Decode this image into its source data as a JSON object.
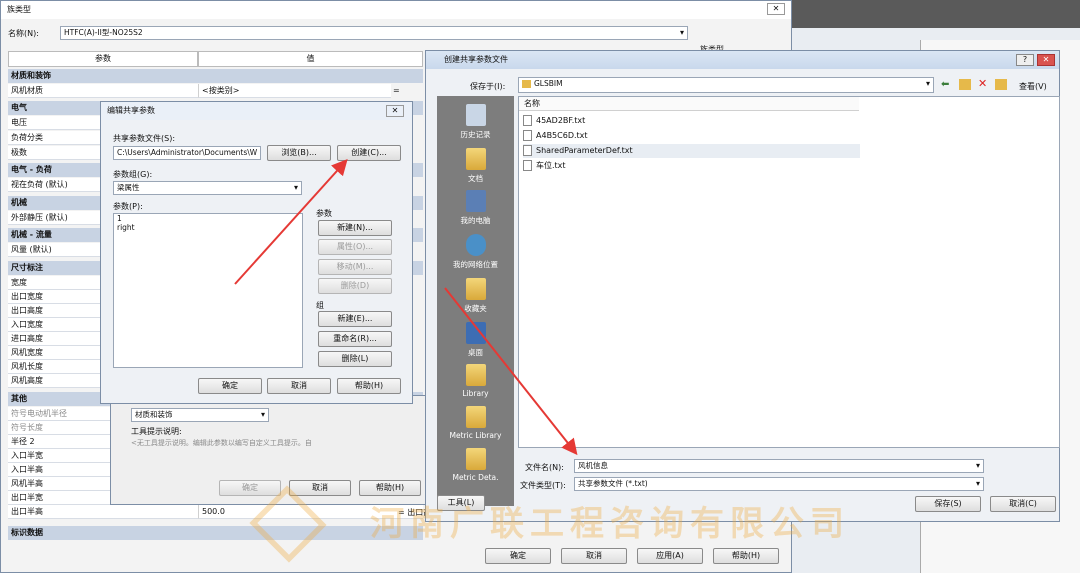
{
  "family_dialog": {
    "title": "族类型",
    "name_label": "名称(N):",
    "name_value": "HTFC(A)-II型-NO25S2",
    "col_param": "参数",
    "col_value": "值",
    "rows": {
      "cat_material": "材质和装饰",
      "fan_material": "风机材质",
      "fan_material_value": "<按类别>",
      "fan_material_eq": "=",
      "cat_electrical": "电气",
      "voltage": "电压",
      "load_class": "负荷分类",
      "poles": "极数",
      "cat_elec_load": "电气 - 负荷",
      "apparent_load": "视在负荷 (默认)",
      "cat_mech": "机械",
      "ext_static": "外部静压 (默认)",
      "cat_mech_flow": "机械 - 流量",
      "air_flow": "风量 (默认)",
      "cat_dims": "尺寸标注",
      "width": "宽度",
      "outlet_width": "出口宽度",
      "outlet_height": "出口高度",
      "inlet_width": "入口宽度",
      "inlet_height": "进口高度",
      "fan_width": "风机宽度",
      "fan_length": "风机长度",
      "fan_height": "风机高度",
      "cat_other": "其他",
      "motor_radius": "符号电动机半径",
      "symbol_length": "符号长度",
      "radius2": "半径 2",
      "inlet_half_width": "入口半宽",
      "inlet_half_height": "入口半高",
      "fan_half_height": "风机半高",
      "outlet_half_width": "出口半宽",
      "outlet_half_height": "出口半高",
      "outlet_half_height_value": "500.0",
      "outlet_half_height_eq": "= 出口高",
      "cat_identity": "标识数据"
    },
    "label_top_right": "族类型",
    "ok": "确定",
    "cancel": "取消",
    "apply": "应用(A)",
    "help": "帮助(H)"
  },
  "param_props_partial": {
    "group_value": "材质和装饰",
    "tooltip_label": "工具提示说明:",
    "tooltip_text": "<无工具提示说明。编辑此参数以编写自定义工具提示。自",
    "ok": "确定",
    "cancel": "取消",
    "help": "帮助(H)"
  },
  "edit_shared_dialog": {
    "title": "编辑共享参数",
    "file_label": "共享参数文件(S):",
    "file_path": "C:\\Users\\Administrator\\Documents\\W",
    "browse": "浏览(B)...",
    "create": "创建(C)...",
    "group_label": "参数组(G):",
    "group_value": "梁属性",
    "params_label": "参数(P):",
    "params": [
      "1",
      "right"
    ],
    "params_section": "参数",
    "p_new": "新建(N)...",
    "p_props": "属性(O)...",
    "p_move": "移动(M)...",
    "p_delete": "删除(D)",
    "group_section": "组",
    "g_new": "新建(E)...",
    "g_rename": "重命名(R)...",
    "g_delete": "删除(L)",
    "ok": "确定",
    "cancel": "取消",
    "help": "帮助(H)"
  },
  "create_file_dialog": {
    "title": "创建共享参数文件",
    "save_in_label": "保存于(I):",
    "save_in_value": "GLSBIM",
    "view_label": "查看(V)",
    "column_name": "名称",
    "files": [
      "45AD2BF.txt",
      "A4B5C6D.txt",
      "SharedParameterDef.txt",
      "车位.txt"
    ],
    "places": [
      "历史记录",
      "文档",
      "我的电脑",
      "我的网络位置",
      "收藏夹",
      "桌面",
      "Library",
      "Metric Library",
      "Metric Deta."
    ],
    "filename_label": "文件名(N):",
    "filename_value": "风机信息",
    "filetype_label": "文件类型(T):",
    "filetype_value": "共享参数文件 (*.txt)",
    "tools": "工具(L)",
    "save": "保存(S)",
    "cancel": "取消(C)"
  },
  "watermark": "河南广联工程咨询有限公司",
  "colors": {
    "arrow": "#e53935",
    "category_bg": "#c8d3e3",
    "places_bg": "#7d7d7d"
  }
}
